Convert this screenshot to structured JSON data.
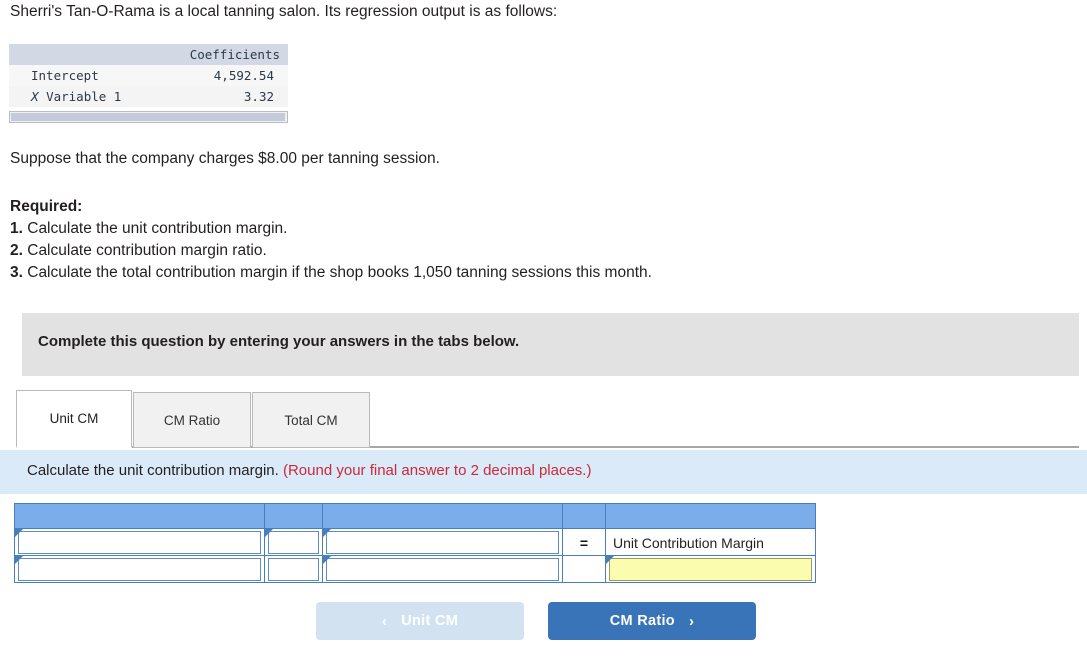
{
  "intro": {
    "text": "Sherri's Tan-O-Rama is a local tanning salon. Its regression output is as follows:"
  },
  "regression_table": {
    "blank_header": "",
    "columns": [
      "",
      "Coefficients"
    ],
    "rows": [
      {
        "label": "Intercept",
        "label_italic_prefix": "",
        "value": "4,592.54"
      },
      {
        "label": "Variable 1",
        "label_italic_prefix": "X",
        "value": "3.32"
      }
    ]
  },
  "suppose": {
    "text": "Suppose that the company charges $8.00 per tanning session."
  },
  "required": {
    "heading": "Required:",
    "items": [
      {
        "num": "1.",
        "text": " Calculate the unit contribution margin."
      },
      {
        "num": "2.",
        "text": " Calculate contribution margin ratio."
      },
      {
        "num": "3.",
        "text": " Calculate the total contribution margin if the shop books 1,050 tanning sessions this month."
      }
    ]
  },
  "gray_banner": {
    "text": "Complete this question by entering your answers in the tabs below."
  },
  "tabs": {
    "active_index": 0,
    "items": [
      {
        "label": "Unit CM"
      },
      {
        "label": "CM Ratio"
      },
      {
        "label": "Total CM"
      }
    ]
  },
  "blue_strip": {
    "prompt": "Calculate the unit contribution margin.",
    "rounding_note": "(Round your final answer to 2 decimal places.)"
  },
  "answer_grid": {
    "header_cells": [
      "",
      "",
      "",
      "",
      ""
    ],
    "row1": {
      "c1_value": "",
      "c2_value": "",
      "c3_value": "",
      "operator": "=",
      "result_label": "Unit Contribution Margin"
    },
    "row2": {
      "c1_value": "",
      "c2_value": "",
      "c3_value": "",
      "operator": "",
      "result_value": ""
    }
  },
  "nav": {
    "prev_label": "Unit CM",
    "prev_chevron": "‹",
    "prev_disabled": true,
    "next_label": "CM Ratio",
    "next_chevron": "›"
  },
  "colors": {
    "header_blue": "#7badea",
    "grid_border_blue": "#4a7ebb",
    "info_strip_blue": "#daeaf8",
    "banner_gray": "#e2e2e2",
    "input_yellow": "#fcfcaf",
    "button_active_blue": "#3a74b8",
    "button_disabled_blue": "#d3e2f1",
    "required_red": "#cc2a36",
    "reg_header_gray": "#d3d9e4"
  }
}
